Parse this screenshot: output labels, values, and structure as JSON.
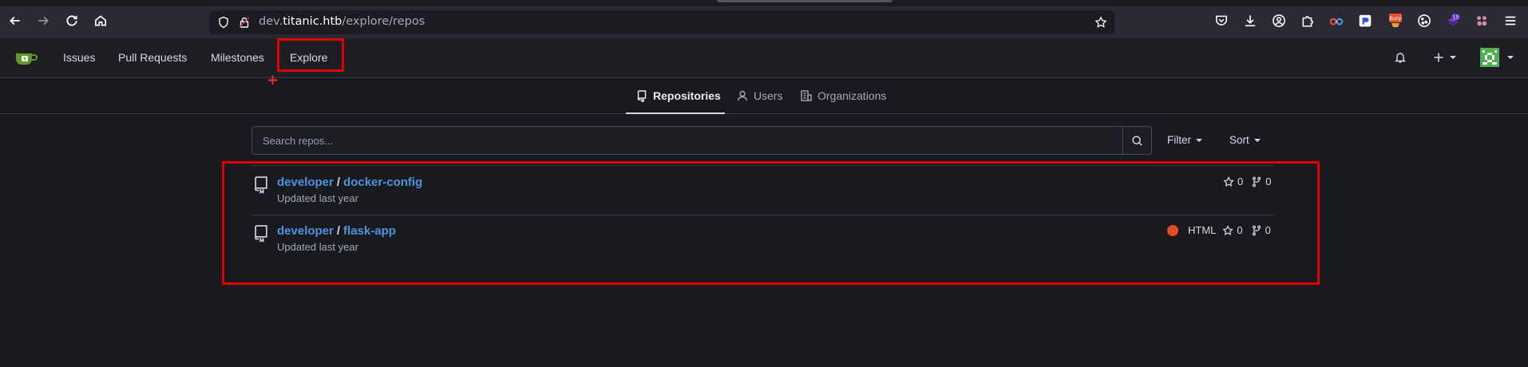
{
  "browser": {
    "url_prefix": "dev.",
    "url_host": "titanic.htb",
    "url_path": "/explore/repos",
    "ext_badge_count": "15",
    "ext_burp_label": "Burp"
  },
  "nav": {
    "links": [
      "Issues",
      "Pull Requests",
      "Milestones",
      "Explore"
    ]
  },
  "tabs": {
    "repositories": "Repositories",
    "users": "Users",
    "organizations": "Organizations"
  },
  "search": {
    "placeholder": "Search repos...",
    "filter_label": "Filter",
    "sort_label": "Sort"
  },
  "repos": [
    {
      "owner": "developer",
      "separator": "/",
      "name": "docker-config",
      "updated": "Updated last year",
      "language": "",
      "stars": "0",
      "forks": "0"
    },
    {
      "owner": "developer",
      "separator": "/",
      "name": "flask-app",
      "updated": "Updated last year",
      "language": "HTML",
      "language_color": "#e34c26",
      "stars": "0",
      "forks": "0"
    }
  ],
  "colors": {
    "accent_link": "#4d94e0",
    "highlight_red": "#e00000",
    "gitea_green": "#609926"
  }
}
